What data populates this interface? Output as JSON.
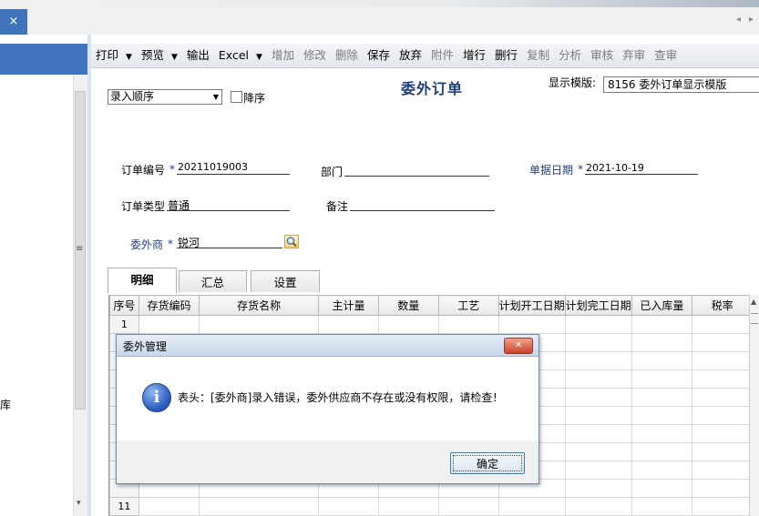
{
  "top_tabs": {
    "close_glyph": "×",
    "left_arrow": "◂",
    "right_arrow": "▸"
  },
  "left_panel": {
    "partial_item": "库",
    "scroll_glyph": "≡",
    "scroll_down": "▾"
  },
  "toolbar": [
    {
      "label": "打印",
      "dropdown": true,
      "enabled": true
    },
    {
      "label": "预览",
      "dropdown": true,
      "enabled": true
    },
    {
      "label": "输出",
      "dropdown": false,
      "enabled": true
    },
    {
      "label": "Excel",
      "dropdown": true,
      "enabled": true
    },
    {
      "label": "增加",
      "dropdown": false,
      "enabled": false
    },
    {
      "label": "修改",
      "dropdown": false,
      "enabled": false
    },
    {
      "label": "删除",
      "dropdown": false,
      "enabled": false
    },
    {
      "label": "保存",
      "dropdown": false,
      "enabled": true
    },
    {
      "label": "放弃",
      "dropdown": false,
      "enabled": true
    },
    {
      "label": "附件",
      "dropdown": false,
      "enabled": false
    },
    {
      "label": "增行",
      "dropdown": false,
      "enabled": true
    },
    {
      "label": "删行",
      "dropdown": false,
      "enabled": true
    },
    {
      "label": "复制",
      "dropdown": false,
      "enabled": false
    },
    {
      "label": "分析",
      "dropdown": false,
      "enabled": false
    },
    {
      "label": "审核",
      "dropdown": false,
      "enabled": false
    },
    {
      "label": "弃审",
      "dropdown": false,
      "enabled": false
    },
    {
      "label": "查审",
      "dropdown": false,
      "enabled": false
    }
  ],
  "form": {
    "title": "委外订单",
    "sort_select": "录入顺序",
    "desc_label": "降序",
    "template_label": "显示模版:",
    "template_value": "8156 委外订单显示模版",
    "required_mark": "*",
    "order_no_label": "订单编号",
    "order_no_value": "20211019003",
    "dept_label": "部门",
    "doc_date_label": "单据日期",
    "doc_date_value": "2021-10-19",
    "order_type_label": "订单类型",
    "order_type_value": "普通",
    "remark_label": "备注",
    "vendor_label": "委外商",
    "vendor_value": "锐河"
  },
  "tabs": [
    {
      "label": "明细",
      "active": true
    },
    {
      "label": "汇总",
      "active": false
    },
    {
      "label": "设置",
      "active": false
    }
  ],
  "grid": {
    "columns": [
      "序号",
      "存货编码",
      "存货名称",
      "主计量",
      "数量",
      "工艺",
      "计划开工日期",
      "计划完工日期",
      "已入库量",
      "税率"
    ],
    "visible_row_numbers": [
      "1",
      "11"
    ]
  },
  "dialog": {
    "title": "委外管理",
    "close_glyph": "✕",
    "icon_glyph": "i",
    "message": "表头：[委外商]录入错误，委外供应商不存在或没有权限，请检查！",
    "ok_label": "确定"
  }
}
